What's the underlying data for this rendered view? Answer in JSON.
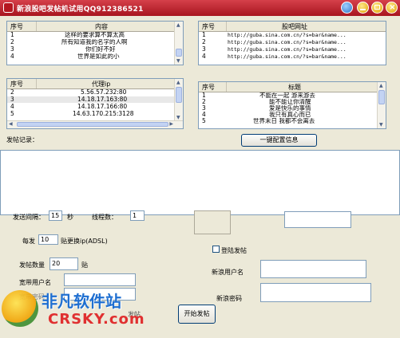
{
  "window": {
    "title": "新浪股吧发帖机试用QQ912386521"
  },
  "content_table": {
    "headers": [
      "序号",
      "内容"
    ],
    "rows": [
      [
        "1",
        "这样的要求算不算太高"
      ],
      [
        "2",
        "所有知道我的名字的人啊"
      ],
      [
        "3",
        "你们好不好"
      ],
      [
        "4",
        "世界是如此的小"
      ]
    ]
  },
  "url_table": {
    "headers": [
      "序号",
      "股吧网址"
    ],
    "rows": [
      [
        "1",
        "http://guba.sina.com.cn/?s=bar&name..."
      ],
      [
        "2",
        "http://guba.sina.com.cn/?s=bar&name..."
      ],
      [
        "3",
        "http://guba.sina.com.cn/?s=bar&name..."
      ],
      [
        "4",
        "http://guba.sina.com.cn/?s=bar&name..."
      ]
    ]
  },
  "proxy_table": {
    "headers": [
      "序号",
      "代理ip"
    ],
    "rows": [
      [
        "2",
        "5.56.57.232:80"
      ],
      [
        "3",
        "14.18.17.163:80"
      ],
      [
        "4",
        "14.18.17.166:80"
      ],
      [
        "5",
        "14.63.170.215:3128"
      ]
    ]
  },
  "title_table": {
    "headers": [
      "序号",
      "标题"
    ],
    "rows": [
      [
        "1",
        "不能在一起 游来游去"
      ],
      [
        "2",
        "能不能让你清醒"
      ],
      [
        "3",
        "爱是快乐的事情"
      ],
      [
        "4",
        "我只有真心而已"
      ],
      [
        "5",
        "世界末日 我都不会离去"
      ]
    ]
  },
  "buttons": {
    "one_click_config": "一键配置信息",
    "start_post": "开始发帖"
  },
  "post_log": {
    "label": "发帖记录："
  },
  "settings": {
    "interval_label": "发送间隔：",
    "interval_value": "15",
    "interval_unit": "秒",
    "threads_label": "线程数：",
    "threads_value": "1",
    "every_label": "每发",
    "every_value": "10",
    "every_suffix": "贴更换ip(ADSL)",
    "post_count_label": "发帖数量",
    "post_count_value": "20",
    "post_count_unit": "贴",
    "broadband_user_label": "宽带用户名",
    "broadband_pass_label": "宽带密码",
    "login_post_label": "登陆发帖",
    "sina_user_label": "新浪用户名",
    "sina_pass_label": "新浪密码",
    "start_post_hidden": "发帖"
  },
  "watermark": {
    "name": "非凡软件站",
    "domain": "CRSKY.com"
  },
  "colors": {
    "titlebar": "#c0222c",
    "face": "#ece9d8",
    "border": "#7f9db9"
  }
}
